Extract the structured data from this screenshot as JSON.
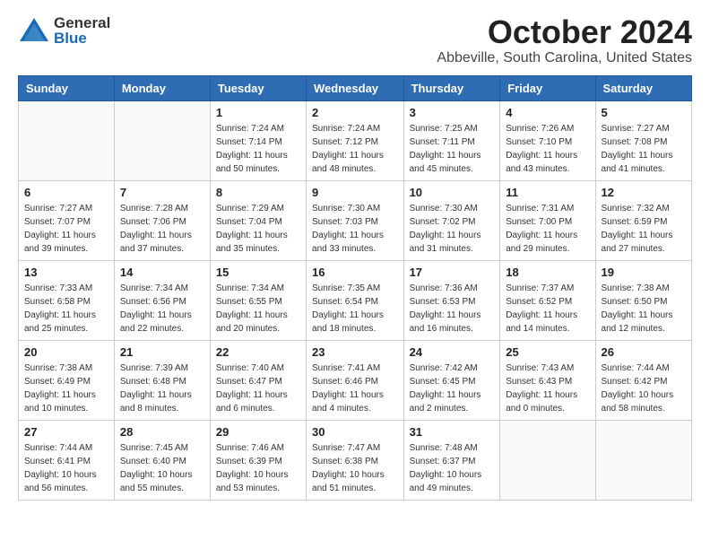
{
  "header": {
    "logo_general": "General",
    "logo_blue": "Blue",
    "month": "October 2024",
    "location": "Abbeville, South Carolina, United States"
  },
  "days_of_week": [
    "Sunday",
    "Monday",
    "Tuesday",
    "Wednesday",
    "Thursday",
    "Friday",
    "Saturday"
  ],
  "weeks": [
    [
      {
        "day": "",
        "info": ""
      },
      {
        "day": "",
        "info": ""
      },
      {
        "day": "1",
        "info": "Sunrise: 7:24 AM\nSunset: 7:14 PM\nDaylight: 11 hours and 50 minutes."
      },
      {
        "day": "2",
        "info": "Sunrise: 7:24 AM\nSunset: 7:12 PM\nDaylight: 11 hours and 48 minutes."
      },
      {
        "day": "3",
        "info": "Sunrise: 7:25 AM\nSunset: 7:11 PM\nDaylight: 11 hours and 45 minutes."
      },
      {
        "day": "4",
        "info": "Sunrise: 7:26 AM\nSunset: 7:10 PM\nDaylight: 11 hours and 43 minutes."
      },
      {
        "day": "5",
        "info": "Sunrise: 7:27 AM\nSunset: 7:08 PM\nDaylight: 11 hours and 41 minutes."
      }
    ],
    [
      {
        "day": "6",
        "info": "Sunrise: 7:27 AM\nSunset: 7:07 PM\nDaylight: 11 hours and 39 minutes."
      },
      {
        "day": "7",
        "info": "Sunrise: 7:28 AM\nSunset: 7:06 PM\nDaylight: 11 hours and 37 minutes."
      },
      {
        "day": "8",
        "info": "Sunrise: 7:29 AM\nSunset: 7:04 PM\nDaylight: 11 hours and 35 minutes."
      },
      {
        "day": "9",
        "info": "Sunrise: 7:30 AM\nSunset: 7:03 PM\nDaylight: 11 hours and 33 minutes."
      },
      {
        "day": "10",
        "info": "Sunrise: 7:30 AM\nSunset: 7:02 PM\nDaylight: 11 hours and 31 minutes."
      },
      {
        "day": "11",
        "info": "Sunrise: 7:31 AM\nSunset: 7:00 PM\nDaylight: 11 hours and 29 minutes."
      },
      {
        "day": "12",
        "info": "Sunrise: 7:32 AM\nSunset: 6:59 PM\nDaylight: 11 hours and 27 minutes."
      }
    ],
    [
      {
        "day": "13",
        "info": "Sunrise: 7:33 AM\nSunset: 6:58 PM\nDaylight: 11 hours and 25 minutes."
      },
      {
        "day": "14",
        "info": "Sunrise: 7:34 AM\nSunset: 6:56 PM\nDaylight: 11 hours and 22 minutes."
      },
      {
        "day": "15",
        "info": "Sunrise: 7:34 AM\nSunset: 6:55 PM\nDaylight: 11 hours and 20 minutes."
      },
      {
        "day": "16",
        "info": "Sunrise: 7:35 AM\nSunset: 6:54 PM\nDaylight: 11 hours and 18 minutes."
      },
      {
        "day": "17",
        "info": "Sunrise: 7:36 AM\nSunset: 6:53 PM\nDaylight: 11 hours and 16 minutes."
      },
      {
        "day": "18",
        "info": "Sunrise: 7:37 AM\nSunset: 6:52 PM\nDaylight: 11 hours and 14 minutes."
      },
      {
        "day": "19",
        "info": "Sunrise: 7:38 AM\nSunset: 6:50 PM\nDaylight: 11 hours and 12 minutes."
      }
    ],
    [
      {
        "day": "20",
        "info": "Sunrise: 7:38 AM\nSunset: 6:49 PM\nDaylight: 11 hours and 10 minutes."
      },
      {
        "day": "21",
        "info": "Sunrise: 7:39 AM\nSunset: 6:48 PM\nDaylight: 11 hours and 8 minutes."
      },
      {
        "day": "22",
        "info": "Sunrise: 7:40 AM\nSunset: 6:47 PM\nDaylight: 11 hours and 6 minutes."
      },
      {
        "day": "23",
        "info": "Sunrise: 7:41 AM\nSunset: 6:46 PM\nDaylight: 11 hours and 4 minutes."
      },
      {
        "day": "24",
        "info": "Sunrise: 7:42 AM\nSunset: 6:45 PM\nDaylight: 11 hours and 2 minutes."
      },
      {
        "day": "25",
        "info": "Sunrise: 7:43 AM\nSunset: 6:43 PM\nDaylight: 11 hours and 0 minutes."
      },
      {
        "day": "26",
        "info": "Sunrise: 7:44 AM\nSunset: 6:42 PM\nDaylight: 10 hours and 58 minutes."
      }
    ],
    [
      {
        "day": "27",
        "info": "Sunrise: 7:44 AM\nSunset: 6:41 PM\nDaylight: 10 hours and 56 minutes."
      },
      {
        "day": "28",
        "info": "Sunrise: 7:45 AM\nSunset: 6:40 PM\nDaylight: 10 hours and 55 minutes."
      },
      {
        "day": "29",
        "info": "Sunrise: 7:46 AM\nSunset: 6:39 PM\nDaylight: 10 hours and 53 minutes."
      },
      {
        "day": "30",
        "info": "Sunrise: 7:47 AM\nSunset: 6:38 PM\nDaylight: 10 hours and 51 minutes."
      },
      {
        "day": "31",
        "info": "Sunrise: 7:48 AM\nSunset: 6:37 PM\nDaylight: 10 hours and 49 minutes."
      },
      {
        "day": "",
        "info": ""
      },
      {
        "day": "",
        "info": ""
      }
    ]
  ]
}
